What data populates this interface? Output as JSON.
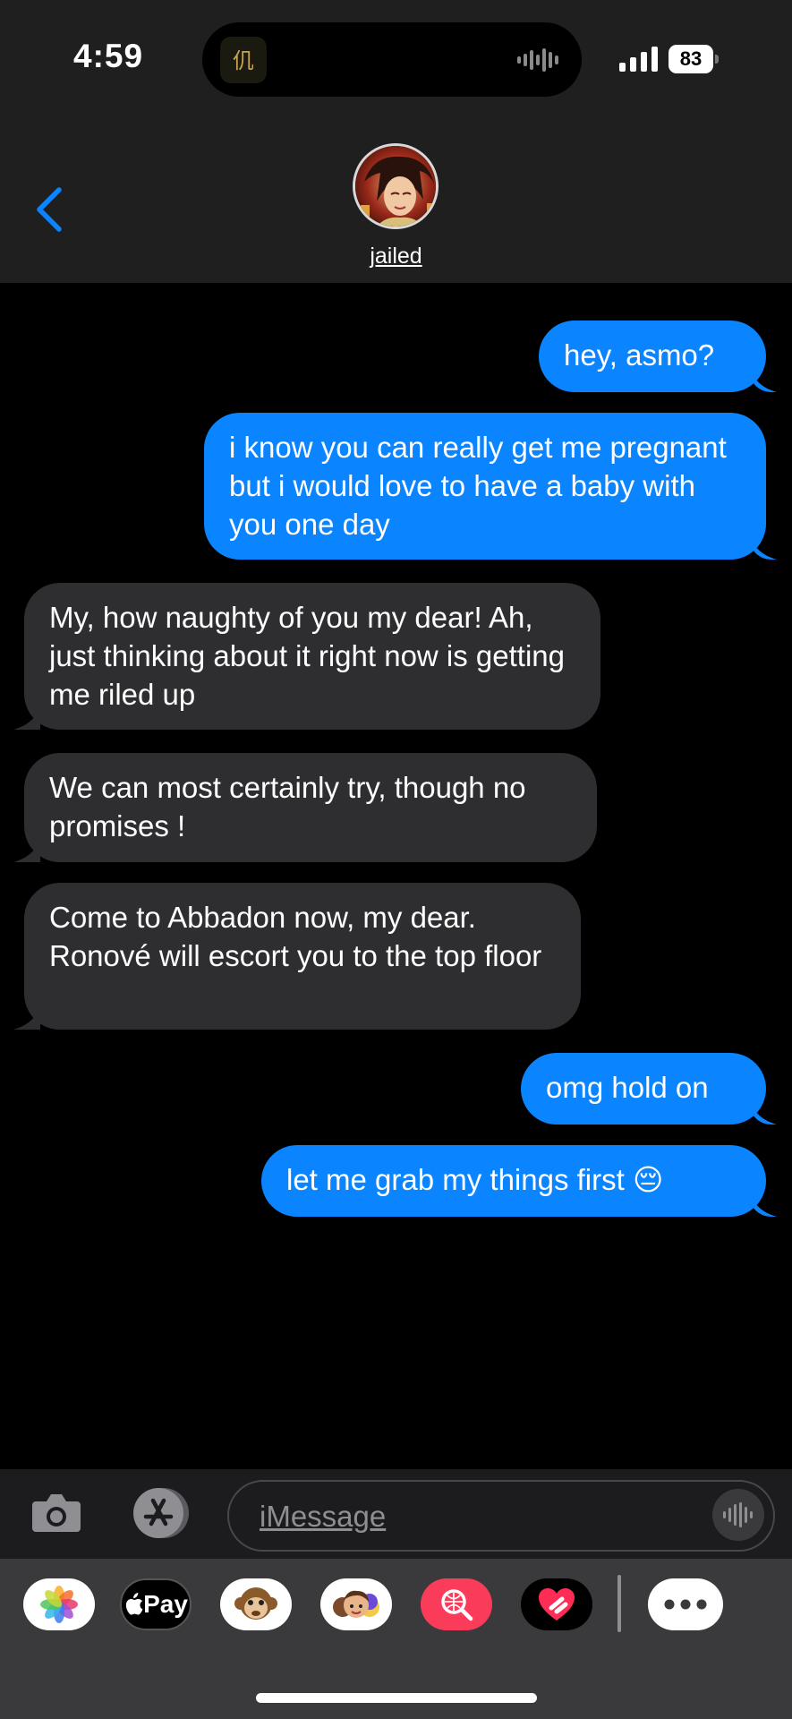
{
  "status_bar": {
    "time": "4:59",
    "battery": "83"
  },
  "header": {
    "contact_name": "jailed"
  },
  "messages": [
    {
      "direction": "sent",
      "text": "hey, asmo?"
    },
    {
      "direction": "sent",
      "text": "i know you can really get me pregnant but i would love to have a baby with you one day"
    },
    {
      "direction": "received",
      "text": "My, how naughty of you my dear! Ah, just thinking about it right now is getting me riled up"
    },
    {
      "direction": "received",
      "text": "We can most certainly try, though no promises !"
    },
    {
      "direction": "received",
      "text": "Come to Abbadon now, my dear. Ronové will escort you to the top floor"
    },
    {
      "direction": "sent",
      "text": "omg hold on"
    },
    {
      "direction": "sent",
      "text": "let me grab my things first 😔"
    }
  ],
  "composer": {
    "placeholder": "iMessage"
  },
  "app_drawer": {
    "apps": [
      "photos-icon",
      "apple-pay-icon",
      "memoji-monkey-icon",
      "memoji-people-icon",
      "image-search-icon",
      "digital-touch-icon",
      "more-icon"
    ],
    "apple_pay_label": "Pay"
  },
  "colors": {
    "sent_bubble": "#0a84ff",
    "received_bubble": "#2e2e30",
    "background": "#000000",
    "header": "#1f1f1f",
    "accent": "#0a84ff"
  }
}
